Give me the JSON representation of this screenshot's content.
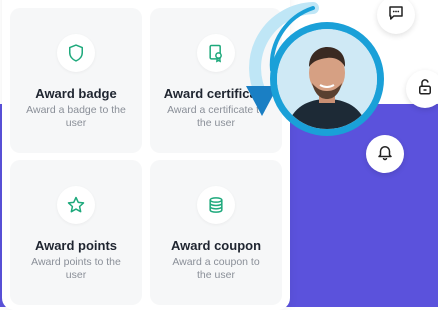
{
  "cards": [
    {
      "title": "Award badge",
      "desc": "Award a badge to the user",
      "icon": "shield-icon"
    },
    {
      "title": "Award certificate",
      "desc": "Award a certificate to the user",
      "icon": "certificate-icon"
    },
    {
      "title": "Award points",
      "desc": "Award points to the user",
      "icon": "star-icon"
    },
    {
      "title": "Award coupon",
      "desc": "Award a coupon to the user",
      "icon": "coupon-icon"
    }
  ],
  "colors": {
    "accent": "#1aa0d8",
    "icon_green": "#1ea97c",
    "purple": "#5b52dc"
  }
}
